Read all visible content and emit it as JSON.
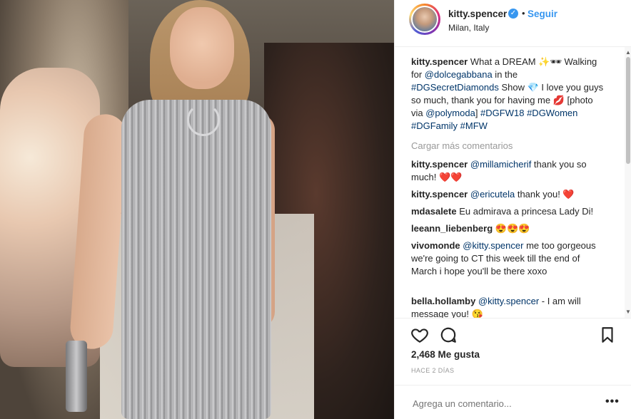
{
  "post": {
    "username": "kitty.spencer",
    "follow_label": "Seguir",
    "location": "Milan, Italy",
    "verified_icon": "verified-badge-icon"
  },
  "caption": {
    "user": "kitty.spencer",
    "t1": " What a DREAM ✨🕶 Walking for ",
    "m1": "@dolcegabbana",
    "t2": " in the ",
    "h1": "#DGSecretDiamonds",
    "t3": " Show 💎 I love you guys so much, thank you for having me 💋 [photo via ",
    "m2": "@polymoda",
    "t4": "] ",
    "h2": "#DGFW18",
    "t5": " ",
    "h3": "#DGWomen",
    "t6": " ",
    "h4": "#DGFamily",
    "t7": " ",
    "h5": "#MFW"
  },
  "load_more": "Cargar más comentarios",
  "comments": [
    {
      "user": "kitty.spencer",
      "mention": "@millamicherif",
      "text": " thank you so much! ❤️❤️"
    },
    {
      "user": "kitty.spencer",
      "mention": "@ericutela",
      "text": " thank you! ❤️"
    },
    {
      "user": "mdasalete",
      "mention": "",
      "text": " Eu admirava a princesa Lady Di!"
    },
    {
      "user": "leeann_liebenberg",
      "mention": "",
      "text": " 😍😍😍"
    },
    {
      "user": "vivomonde",
      "mention": "@kitty.spencer",
      "text": " me too gorgeous we're going to CT this week till the end of March i hope you'll be there xoxo"
    },
    {
      "user": "bella.hollamby",
      "mention": "@kitty.spencer",
      "text": " - I am will message you! 😘"
    }
  ],
  "likes": "2,468 Me gusta",
  "time": "HACE 2 DÍAS",
  "comment_input": {
    "placeholder": "Agrega un comentario..."
  },
  "icons": {
    "like": "heart-icon",
    "comment": "comment-bubble-icon",
    "save": "bookmark-icon",
    "options": "more-options-icon"
  }
}
